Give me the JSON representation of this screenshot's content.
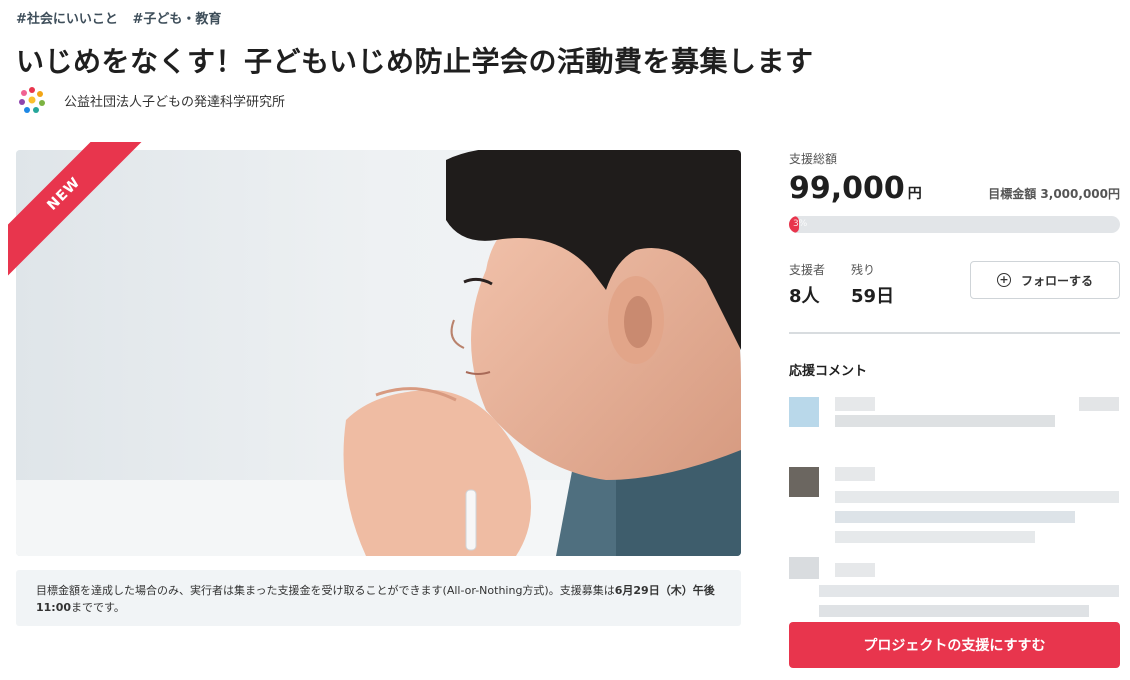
{
  "tags": [
    "#社会にいいこと",
    "#子ども・教育"
  ],
  "title": "いじめをなくす！子どもいじめ防止学会の活動費を募集します",
  "organization": {
    "name": "公益社団法人子どもの発達科学研究所",
    "logo_icon": "flower-logo-icon"
  },
  "hero": {
    "ribbon_label": "NEW",
    "image": "child-thinking-photo"
  },
  "note": {
    "text_before": "目標金額を達成した場合のみ、実行者は集まった支援金を受け取ることができます(All-or-Nothing方式)。支援募集は",
    "text_bold": "6月29日（木）午後11:00",
    "text_after": "までです。"
  },
  "funding": {
    "total_label": "支援総額",
    "amount": "99,000",
    "unit": "円",
    "goal_label": "目標金額",
    "goal_amount": "3,000,000円",
    "progress_percent": 3,
    "progress_label": "3%"
  },
  "stats": {
    "supporters_label": "支援者",
    "supporters_value": "8人",
    "remaining_label": "残り",
    "remaining_value": "59日"
  },
  "follow_button": {
    "label": "フォローする",
    "icon": "plus-circle-icon"
  },
  "comments": {
    "heading": "応援コメント"
  },
  "cta": {
    "label": "プロジェクトの支援にすすむ"
  },
  "colors": {
    "accent": "#e8354d",
    "progress_track": "#e2e5e8",
    "note_bg": "#f1f4f6"
  }
}
